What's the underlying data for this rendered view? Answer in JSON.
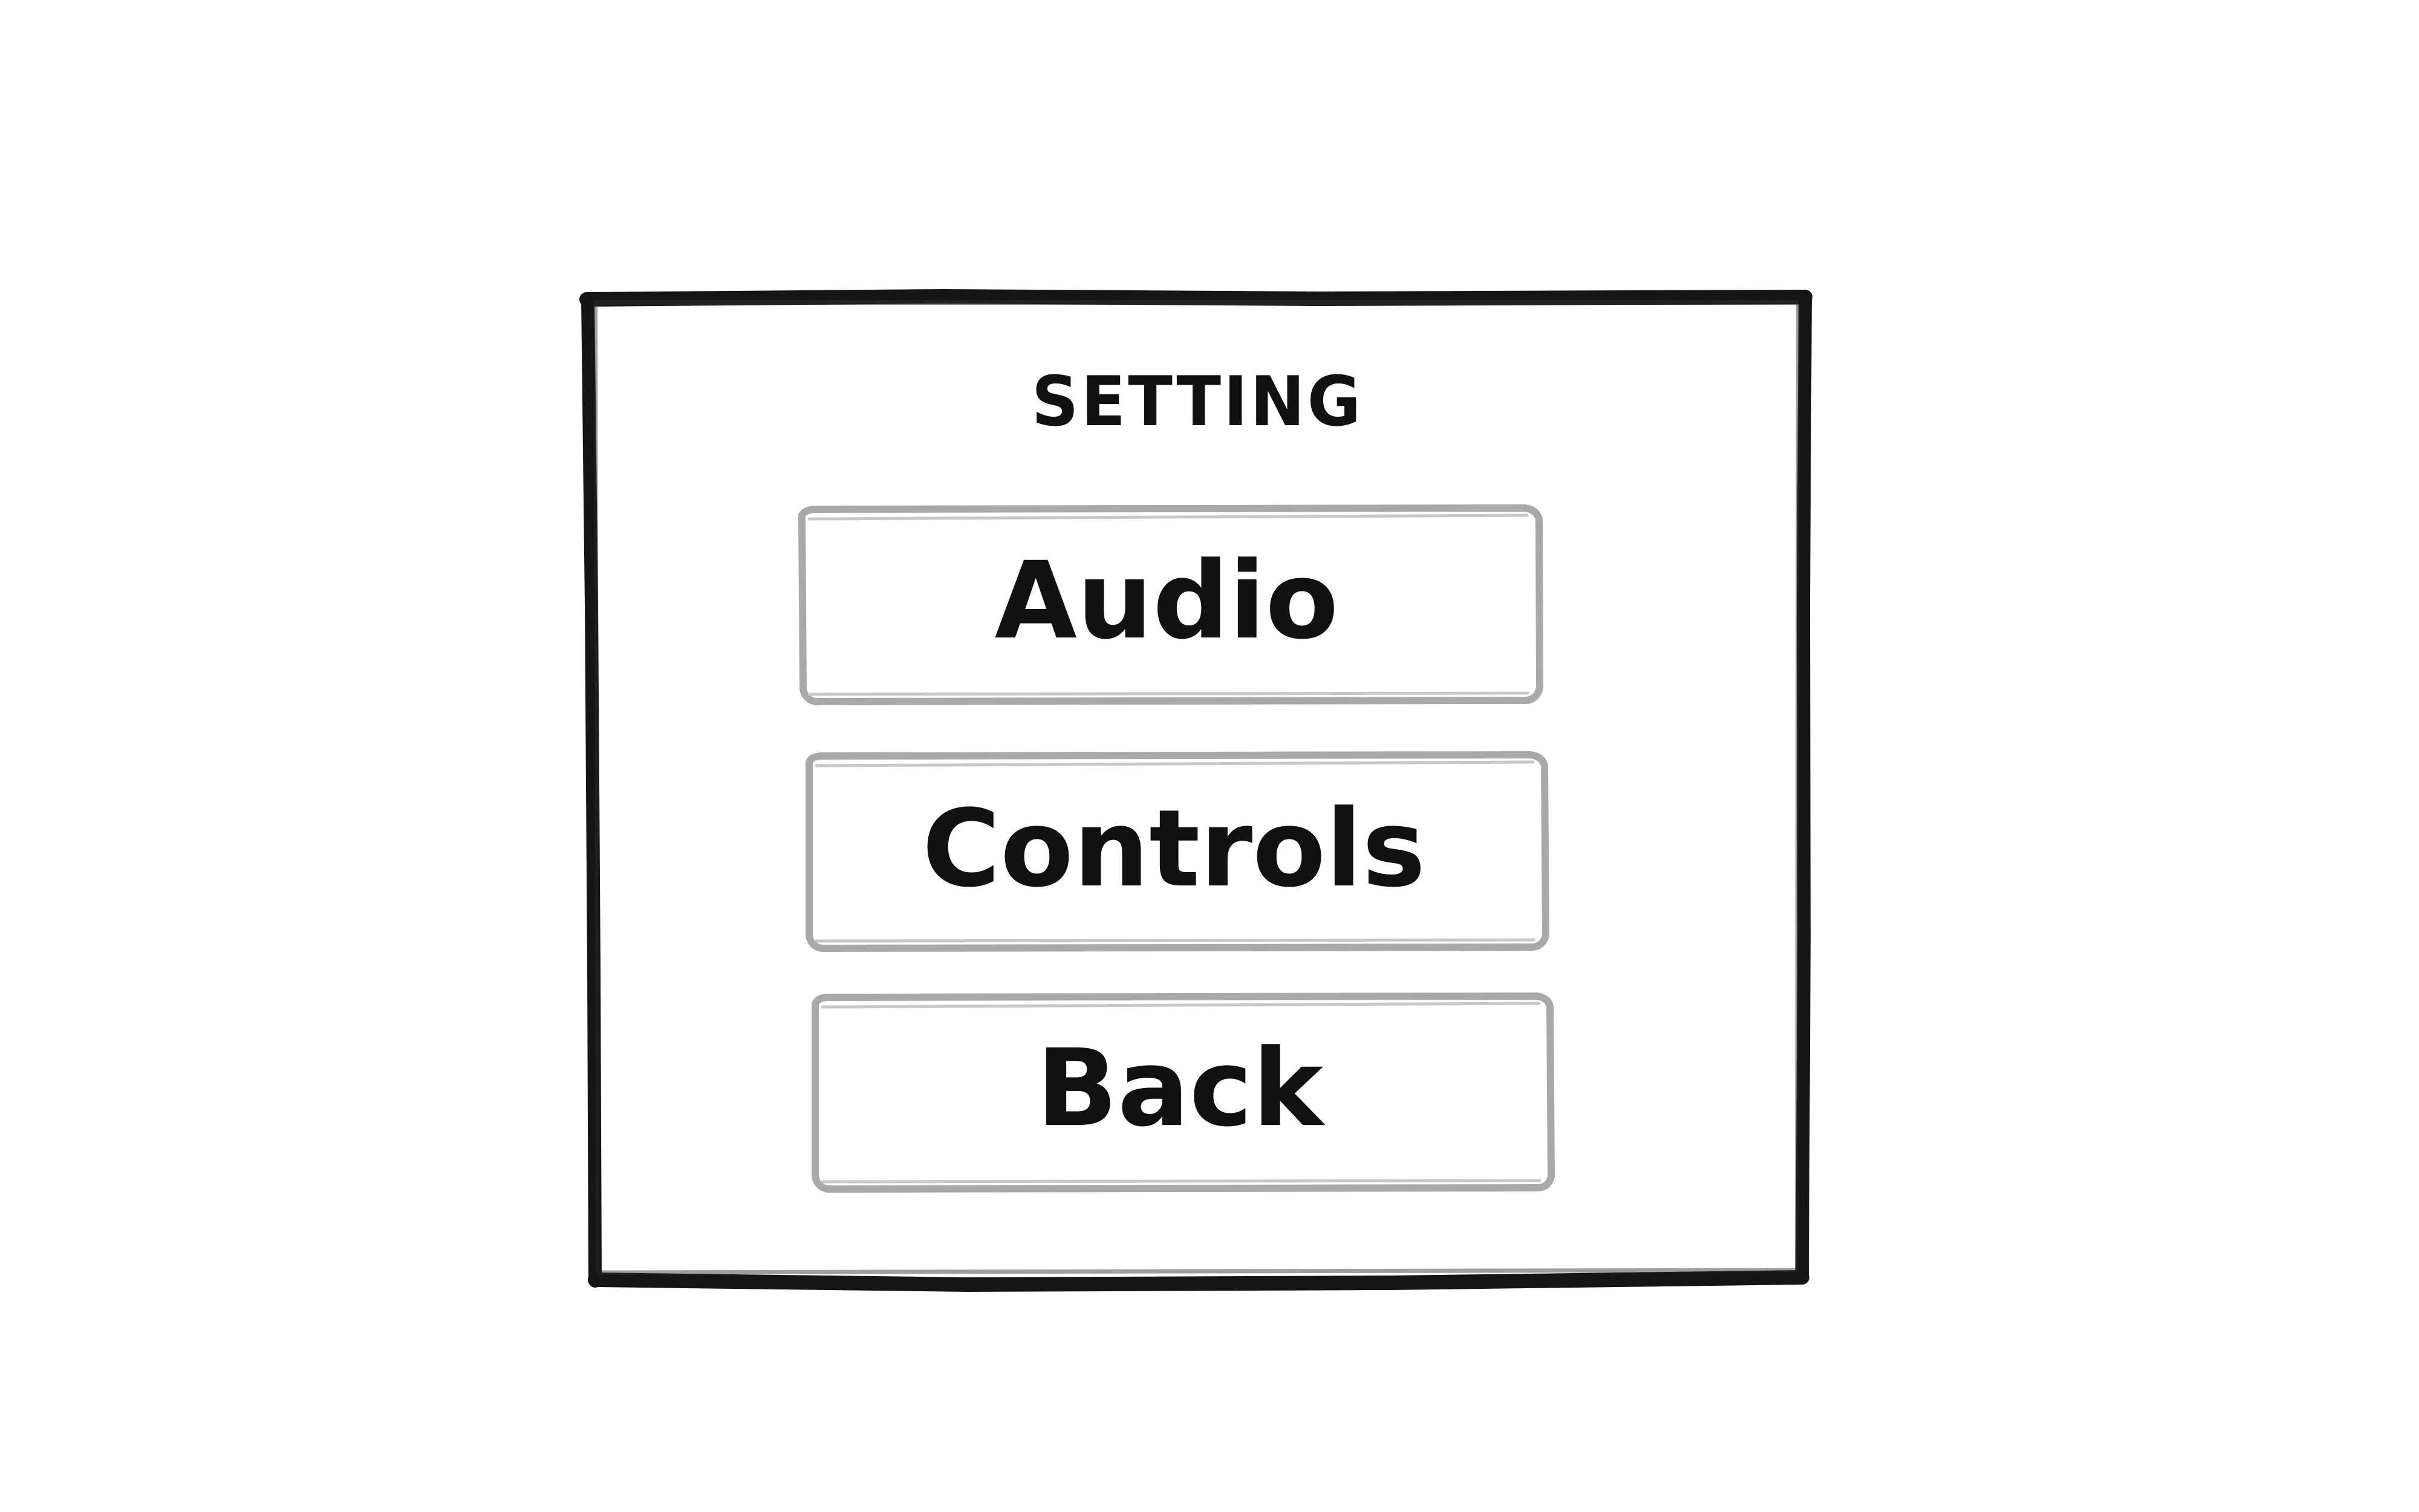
{
  "screen": {
    "title": "SETTING"
  },
  "buttons": {
    "audio_label": "Audio",
    "controls_label": "Controls",
    "back_label": "Back"
  },
  "colors": {
    "ink": "#111111",
    "button_outline": "#a9a9a9",
    "background": "#ffffff"
  }
}
